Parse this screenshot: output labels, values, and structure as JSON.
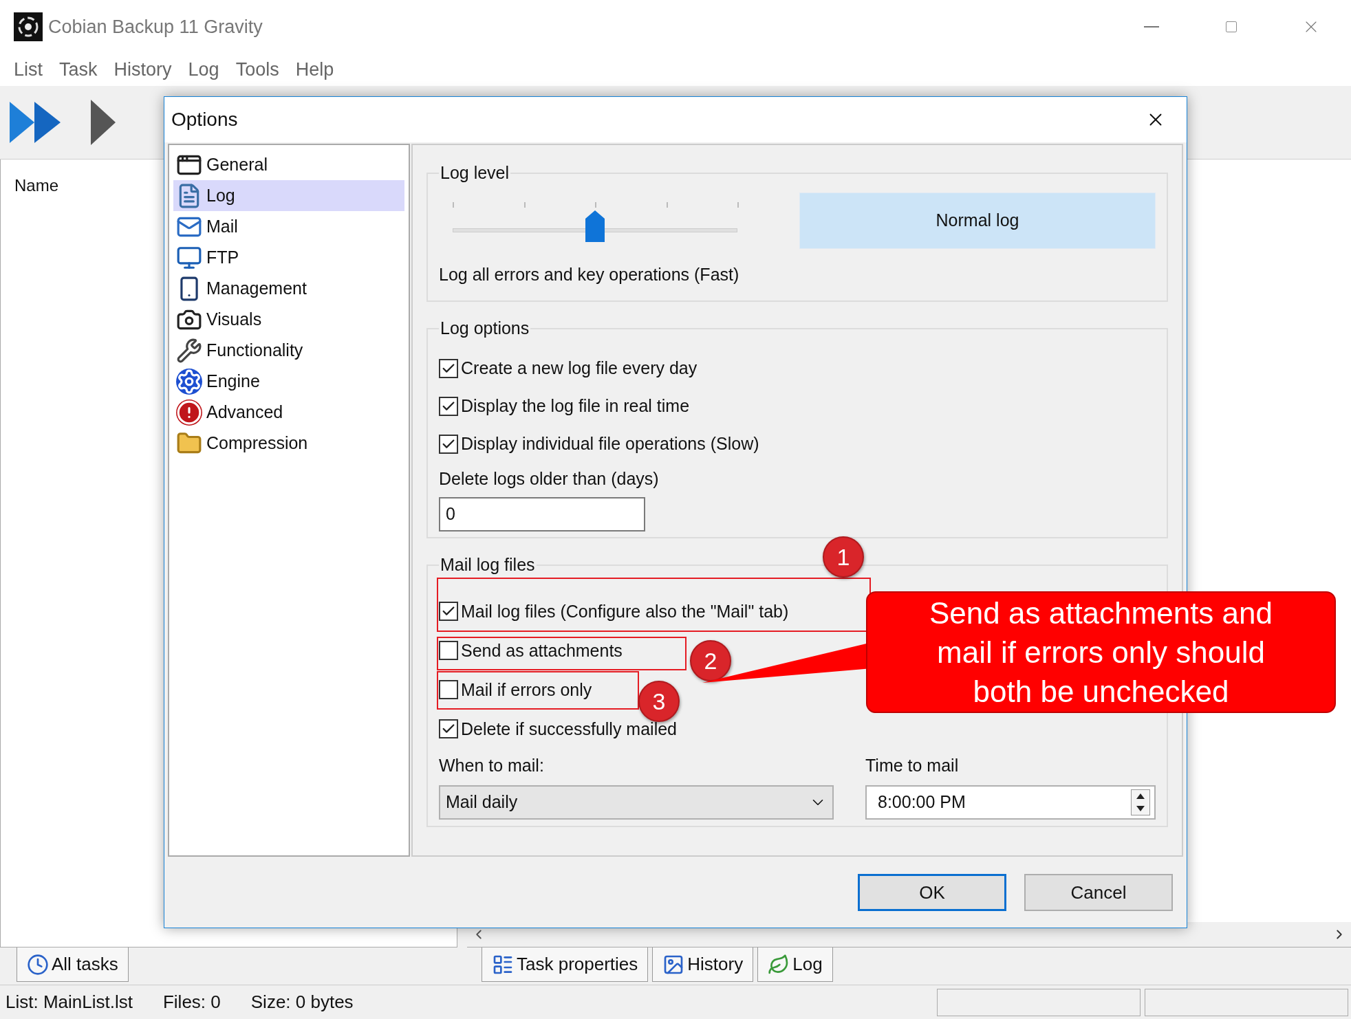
{
  "window": {
    "title": "Cobian Backup 11 Gravity"
  },
  "menu": [
    "List",
    "Task",
    "History",
    "Log",
    "Tools",
    "Help"
  ],
  "task_list": {
    "column": "Name"
  },
  "left_tabs": [
    "All tasks"
  ],
  "right_tabs": [
    "Task properties",
    "History",
    "Log"
  ],
  "status_bar": [
    "List: MainList.lst",
    "Files: 0",
    "Size: 0 bytes"
  ],
  "dialog": {
    "title": "Options",
    "categories": [
      {
        "label": "General",
        "selected": false
      },
      {
        "label": "Log",
        "selected": true
      },
      {
        "label": "Mail",
        "selected": false
      },
      {
        "label": "FTP",
        "selected": false
      },
      {
        "label": "Management",
        "selected": false
      },
      {
        "label": "Visuals",
        "selected": false
      },
      {
        "label": "Functionality",
        "selected": false
      },
      {
        "label": "Engine",
        "selected": false
      },
      {
        "label": "Advanced",
        "selected": false
      },
      {
        "label": "Compression",
        "selected": false
      }
    ],
    "log_level": {
      "title": "Log level",
      "level": 0.5,
      "value": "Normal log",
      "description": "Log all errors and key operations (Fast)"
    },
    "log_options": {
      "title": "Log options",
      "checkboxes": [
        {
          "label": "Create a new log file every day",
          "checked": true
        },
        {
          "label": "Display the log file in real time",
          "checked": true
        },
        {
          "label": "Display individual file operations (Slow)",
          "checked": true
        }
      ],
      "delete_label": "Delete logs older than (days)",
      "delete_value": "0"
    },
    "mail_log_files": {
      "title": "Mail log files",
      "checkboxes": [
        {
          "label": "Mail log files (Configure also the \"Mail\" tab)",
          "checked": true
        },
        {
          "label": "Send as attachments",
          "checked": false
        },
        {
          "label": "Mail if errors only",
          "checked": false
        },
        {
          "label": "Delete if successfully mailed",
          "checked": true
        }
      ],
      "when_label": "When to mail:",
      "when_value": "Mail daily",
      "time_label": "Time to mail",
      "time_value": "8:00:00 PM"
    },
    "buttons": [
      {
        "label": "OK",
        "default": true
      },
      {
        "label": "Cancel",
        "default": false
      }
    ]
  },
  "annotations": {
    "markers": [
      "1",
      "2",
      "3"
    ],
    "callout": "Send as attachments and mail if errors only should both be unchecked"
  }
}
